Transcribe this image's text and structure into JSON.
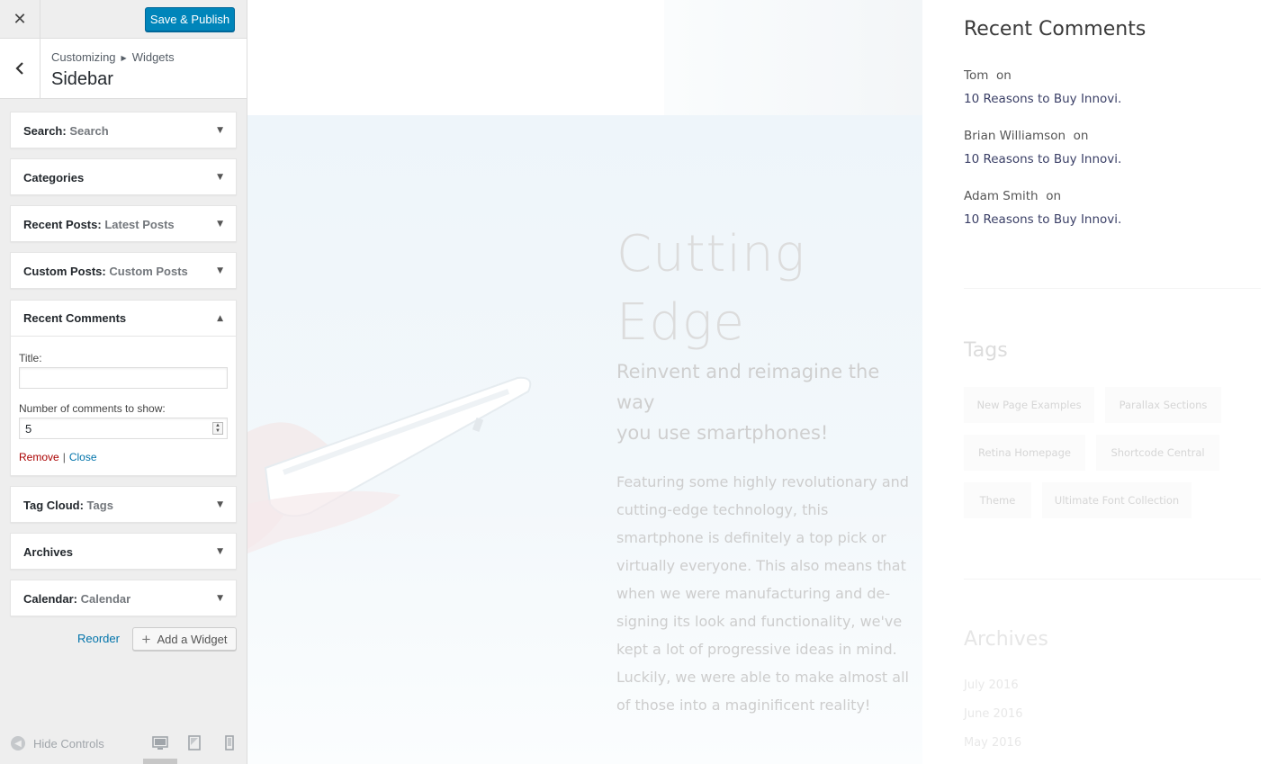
{
  "header": {
    "close_label": "✕",
    "save_publish": "Save & Publish"
  },
  "section": {
    "breadcrumb_root": "Customizing",
    "breadcrumb_child": "Widgets",
    "title": "Sidebar"
  },
  "widgets": [
    {
      "name": "Search",
      "sub": "Search"
    },
    {
      "name": "Categories",
      "sub": ""
    },
    {
      "name": "Recent Posts",
      "sub": "Latest Posts"
    },
    {
      "name": "Custom Posts",
      "sub": "Custom Posts"
    },
    {
      "name": "Recent Comments",
      "sub": ""
    },
    {
      "name": "Tag Cloud",
      "sub": "Tags"
    },
    {
      "name": "Archives",
      "sub": ""
    },
    {
      "name": "Calendar",
      "sub": "Calendar"
    }
  ],
  "recent_comments_form": {
    "title_label": "Title:",
    "title_value": "",
    "number_label": "Number of comments to show:",
    "number_value": "5",
    "remove": "Remove",
    "separator": "|",
    "close": "Close"
  },
  "footer_actions": {
    "reorder": "Reorder",
    "add_widget": "Add a Widget"
  },
  "footer": {
    "hide_controls": "Hide Controls",
    "devices": [
      "desktop-icon",
      "tablet-icon",
      "mobile-icon"
    ]
  },
  "preview": {
    "hero_heading_line1": "Cutting",
    "hero_heading_line2": "Edge",
    "hero_sub_line1": "Reinvent and reimagine the",
    "hero_sub_line2": "way",
    "hero_sub_line3": "you use smartphones!",
    "hero_body": "Featuring some highly revolutionary and cutting-edge technology, this smartphone is definitely a top pick or virtually everyone. This also means that when we were manufacturing and de-signing its look and functionality, we've kept a lot of progressive ideas in mind. Luckily, we were able to make almost all of those into a maginificent reality!",
    "recent_comments_title": "Recent Comments",
    "comments": [
      {
        "author": "Tom",
        "on": "on",
        "post": "10 Reasons to Buy Innovi."
      },
      {
        "author": "Brian Williamson",
        "on": "on",
        "post": "10 Reasons to Buy Innovi."
      },
      {
        "author": "Adam Smith",
        "on": "on",
        "post": "10 Reasons to Buy Innovi."
      }
    ],
    "tags_title": "Tags",
    "tags": [
      "New Page Examples",
      "Parallax Sections",
      "Retina Homepage",
      "Shortcode Central",
      "Theme",
      "Ultimate Font Collection"
    ],
    "archives_title": "Archives",
    "archives": [
      "July 2016",
      "June 2016",
      "May 2016"
    ]
  },
  "colors": {
    "primary_button": "#0085ba",
    "link": "#0073aa",
    "remove_link": "#aa0000"
  }
}
